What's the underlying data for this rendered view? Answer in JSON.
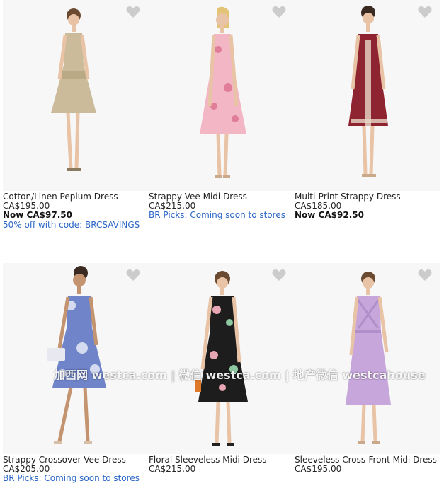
{
  "products": [
    {
      "name": "Cotton/Linen Peplum Dress",
      "price": "CA$195.00",
      "sale_price": "Now CA$97.50",
      "promo": "50% off with code: BRCSAVINGS",
      "dress_color": "#cbbb9a",
      "icon": "heart-icon"
    },
    {
      "name": "Strappy Vee Midi Dress",
      "price": "CA$215.00",
      "promo": "BR Picks: Coming soon to stores",
      "dress_color": "#f2b6c4",
      "icon": "heart-icon"
    },
    {
      "name": "Multi-Print Strappy Dress",
      "price": "CA$185.00",
      "sale_price": "Now CA$92.50",
      "dress_color": "#8e2430",
      "icon": "heart-icon"
    },
    {
      "name": "Strappy Crossover Vee Dress",
      "price": "CA$205.00",
      "promo": "BR Picks: Coming soon to stores",
      "dress_color": "#6f84c9",
      "icon": "heart-icon"
    },
    {
      "name": "Floral Sleeveless Midi Dress",
      "price": "CA$215.00",
      "dress_color": "#1d1d1d",
      "icon": "heart-icon"
    },
    {
      "name": "Sleeveless Cross-Front Midi Dress",
      "price": "CA$195.00",
      "dress_color": "#c7a6dc",
      "icon": "heart-icon"
    }
  ],
  "watermark": "加西网 westca.com | 微信 westca.com | 地产微信 westcahouse",
  "colors": {
    "link": "#2a66c8",
    "heart": "#cccccc",
    "skin": "#e8c3a6",
    "hair": "#6b4a32"
  }
}
